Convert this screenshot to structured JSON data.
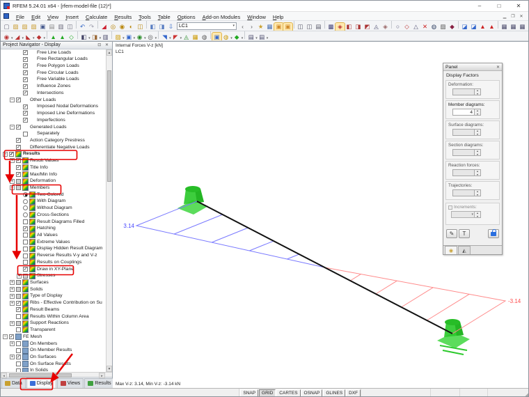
{
  "window": {
    "title": "RFEM 5.24.01 x64 - [rfem-model-file (12)*]",
    "controls": {
      "minimize": "–",
      "maximize": "□",
      "close": "✕"
    }
  },
  "menu": {
    "items": [
      "File",
      "Edit",
      "View",
      "Insert",
      "Calculate",
      "Results",
      "Tools",
      "Table",
      "Options",
      "Add-on Modules",
      "Window",
      "Help"
    ],
    "mdi": [
      "▁",
      "❐",
      "✕"
    ]
  },
  "toolbar": {
    "load_case": "LC1",
    "combo_caret": "▾",
    "row1a": [
      {
        "g": "▢",
        "c": "#667"
      },
      {
        "g": "▨",
        "c": "#c99b2e"
      },
      {
        "g": "▨",
        "c": "#c99b2e"
      },
      {
        "g": "▨",
        "c": "#c99b2e"
      },
      {
        "g": "▣",
        "c": "#44588c"
      },
      {
        "g": "▤",
        "c": "#888"
      },
      {
        "g": "▥",
        "c": "#667"
      },
      {
        "g": "◫",
        "c": "#667"
      },
      {
        "sep": true
      },
      {
        "g": "↶",
        "c": "#2e63c4"
      },
      {
        "g": "↷",
        "c": "#99a"
      },
      {
        "sep": true
      },
      {
        "g": "◢",
        "c": "#c23"
      },
      {
        "g": "◎",
        "c": "#b8860b"
      },
      {
        "g": "◉",
        "c": "#b8860b"
      },
      {
        "g": "◐",
        "c": "#b8860b"
      },
      {
        "g": "◫",
        "c": "#b8860b"
      },
      {
        "sep": true
      },
      {
        "g": "◧",
        "c": "#5a7ec2"
      },
      {
        "g": "◨",
        "c": "#5a7ec2"
      },
      {
        "g": "⇩",
        "c": "#2e63c4"
      }
    ],
    "row1b": [
      {
        "g": "‹",
        "c": "#555"
      },
      {
        "g": "›",
        "c": "#555"
      },
      {
        "g": "★",
        "c": "#caa12e"
      },
      {
        "g": "▦",
        "c": "#4a6faf"
      },
      {
        "g": "▣",
        "c": "#d08a2a",
        "hl": true
      },
      {
        "g": "▣",
        "c": "#d08a2a",
        "hl": true
      },
      {
        "sep": true
      },
      {
        "g": "◫",
        "c": "#556"
      },
      {
        "g": "◫",
        "c": "#556"
      },
      {
        "g": "▤",
        "c": "#556"
      },
      {
        "sep": true
      },
      {
        "g": "▩",
        "c": "#447"
      },
      {
        "g": "◈",
        "c": "#b33",
        "hl": true
      },
      {
        "g": "◧",
        "c": "#a33"
      },
      {
        "g": "◨",
        "c": "#a33"
      },
      {
        "g": "◩",
        "c": "#a33"
      },
      {
        "g": "◬",
        "c": "#557"
      },
      {
        "g": "◈",
        "c": "#966"
      },
      {
        "sep": true
      },
      {
        "g": "○",
        "c": "#557"
      },
      {
        "g": "◇",
        "c": "#b33"
      },
      {
        "g": "△",
        "c": "#557"
      },
      {
        "g": "✕",
        "c": "#c22"
      },
      {
        "g": "◍",
        "c": "#346"
      },
      {
        "g": "▨",
        "c": "#555"
      },
      {
        "g": "◆",
        "c": "#824"
      },
      {
        "sep": true
      },
      {
        "g": "◪",
        "c": "#36c"
      },
      {
        "g": "◪",
        "c": "#36c"
      },
      {
        "g": "▲",
        "c": "#c22"
      },
      {
        "g": "▲",
        "c": "#c22"
      },
      {
        "sep": true
      },
      {
        "g": "▦",
        "c": "#446"
      },
      {
        "g": "▦",
        "c": "#446"
      },
      {
        "g": "▦",
        "c": "#446"
      }
    ],
    "row2": [
      {
        "g": "◉",
        "c": "#b33",
        "dd": true
      },
      {
        "g": "◢",
        "c": "#b33",
        "dd": true
      },
      {
        "g": "◣",
        "c": "#b33",
        "dd": true
      },
      {
        "g": "◆",
        "c": "#b33",
        "dd": true
      },
      {
        "sep": true
      },
      {
        "g": "▲",
        "c": "#2a2"
      },
      {
        "g": "▲",
        "c": "#2a2"
      },
      {
        "g": "◇",
        "c": "#2a2"
      },
      {
        "sep": true
      },
      {
        "g": "◧",
        "c": "#446",
        "dd": true
      },
      {
        "g": "◨",
        "c": "#963",
        "dd": true
      },
      {
        "g": "▥",
        "c": "#446"
      },
      {
        "sep": true
      },
      {
        "g": "▨",
        "c": "#c90",
        "dd": true
      },
      {
        "g": "▣",
        "c": "#36c",
        "dd": true
      },
      {
        "g": "◉",
        "c": "#282",
        "dd": true
      },
      {
        "g": "◎",
        "c": "#555",
        "dd": true
      },
      {
        "sep": true
      },
      {
        "g": "◥",
        "c": "#36c",
        "dd": true
      },
      {
        "g": "◤",
        "c": "#c33",
        "dd": true
      },
      {
        "g": "◬",
        "c": "#282"
      },
      {
        "g": "▦",
        "c": "#c90"
      },
      {
        "g": "◍",
        "c": "#555"
      },
      {
        "sep": true
      },
      {
        "g": "▣",
        "c": "#36c",
        "hl": true
      },
      {
        "g": "◍",
        "c": "#c90",
        "dd": true
      },
      {
        "g": "◆",
        "c": "#2a2",
        "dd": true
      },
      {
        "sep": true
      },
      {
        "g": "▤",
        "c": "#446",
        "dd": true
      },
      {
        "g": "▤",
        "c": "#446",
        "dd": true
      }
    ]
  },
  "navigator": {
    "title": "Project Navigator - Display",
    "pin_icon": "⊡",
    "close_icon": "✕",
    "tree": [
      {
        "label": "Free Line Loads",
        "lv": 2,
        "ctrl": "on",
        "icon": "load"
      },
      {
        "label": "Free Rectangular Loads",
        "lv": 2,
        "ctrl": "on",
        "icon": "load"
      },
      {
        "label": "Free Polygon Loads",
        "lv": 2,
        "ctrl": "on",
        "icon": "load"
      },
      {
        "label": "Free Circular Loads",
        "lv": 2,
        "ctrl": "on",
        "icon": "load"
      },
      {
        "label": "Free Variable Loads",
        "lv": 2,
        "ctrl": "on",
        "icon": "load"
      },
      {
        "label": "Influence Zones",
        "lv": 2,
        "ctrl": "on",
        "icon": "load"
      },
      {
        "label": "Intersections",
        "lv": 2,
        "ctrl": "on",
        "icon": "load"
      },
      {
        "label": "Other Loads",
        "lv": 1,
        "exp": "-",
        "ctrl": "on",
        "icon": "load"
      },
      {
        "label": "Imposed Nodal Deformations",
        "lv": 2,
        "ctrl": "on",
        "icon": "load"
      },
      {
        "label": "Imposed Line Deformations",
        "lv": 2,
        "ctrl": "on",
        "icon": "load"
      },
      {
        "label": "Imperfections",
        "lv": 2,
        "ctrl": "on",
        "icon": "load"
      },
      {
        "label": "Generated Loads",
        "lv": 1,
        "exp": "-",
        "ctrl": "on",
        "icon": "load"
      },
      {
        "label": "Separately",
        "lv": 2,
        "ctrl": "off",
        "icon": "load"
      },
      {
        "label": "Action Category Prestress",
        "lv": 1,
        "ctrl": "on",
        "icon": "load"
      },
      {
        "label": "Differentiate Negative Loads",
        "lv": 1,
        "ctrl": "on",
        "icon": "load"
      },
      {
        "label": "Results",
        "lv": 0,
        "exp": "-",
        "ctrl": "on",
        "icon": "result",
        "bold": true
      },
      {
        "label": "Result Values",
        "lv": 1,
        "exp": "+",
        "ctrl": "on",
        "icon": "result"
      },
      {
        "label": "Title Info",
        "lv": 1,
        "ctrl": "on",
        "icon": "result"
      },
      {
        "label": "Max/Min Info",
        "lv": 1,
        "ctrl": "on",
        "icon": "result"
      },
      {
        "label": "Deformation",
        "lv": 1,
        "exp": "+",
        "ctrl": "part",
        "icon": "result"
      },
      {
        "label": "Members",
        "lv": 1,
        "exp": "-",
        "ctrl": "part",
        "icon": "result"
      },
      {
        "label": "Two-Colored",
        "lv": 2,
        "ctrl": "ron",
        "icon": "result"
      },
      {
        "label": "With Diagram",
        "lv": 2,
        "ctrl": "roff",
        "icon": "result"
      },
      {
        "label": "Without Diagram",
        "lv": 2,
        "ctrl": "roff",
        "icon": "result"
      },
      {
        "label": "Cross-Sections",
        "lv": 2,
        "ctrl": "roff",
        "icon": "result"
      },
      {
        "label": "Result Diagrams Filled",
        "lv": 2,
        "ctrl": "off",
        "icon": "result"
      },
      {
        "label": "Hatching",
        "lv": 2,
        "ctrl": "on",
        "icon": "result"
      },
      {
        "label": "All Values",
        "lv": 2,
        "ctrl": "off",
        "icon": "result"
      },
      {
        "label": "Extreme Values",
        "lv": 2,
        "ctrl": "off",
        "icon": "result"
      },
      {
        "label": "Display Hidden Result Diagram",
        "lv": 2,
        "ctrl": "off",
        "icon": "result"
      },
      {
        "label": "Reverse Results V-y and V-z",
        "lv": 2,
        "ctrl": "off",
        "icon": "result"
      },
      {
        "label": "Results on Couplings",
        "lv": 2,
        "ctrl": "off",
        "icon": "result"
      },
      {
        "label": "Draw in XY-Plane",
        "lv": 2,
        "ctrl": "on",
        "icon": "result"
      },
      {
        "label": "Stresses",
        "lv": 2,
        "exp": "+",
        "ctrl": "part",
        "icon": "result"
      },
      {
        "label": "Surfaces",
        "lv": 1,
        "exp": "+",
        "ctrl": "part",
        "icon": "result"
      },
      {
        "label": "Solids",
        "lv": 1,
        "exp": "+",
        "ctrl": "part",
        "icon": "result"
      },
      {
        "label": "Type of Display",
        "lv": 1,
        "exp": "+",
        "ctrl": "part",
        "icon": "result"
      },
      {
        "label": "Ribs - Effective Contribution on Su",
        "lv": 1,
        "exp": "+",
        "ctrl": "on",
        "icon": "result"
      },
      {
        "label": "Result Beams",
        "lv": 1,
        "ctrl": "on",
        "icon": "result"
      },
      {
        "label": "Results Within Column Area",
        "lv": 1,
        "ctrl": "off",
        "icon": "result"
      },
      {
        "label": "Support Reactions",
        "lv": 1,
        "exp": "+",
        "ctrl": "part",
        "icon": "result"
      },
      {
        "label": "Transparent",
        "lv": 1,
        "ctrl": "off",
        "icon": "result"
      },
      {
        "label": "FE Mesh",
        "lv": 0,
        "exp": "-",
        "ctrl": "on",
        "icon": "mesh"
      },
      {
        "label": "On Members",
        "lv": 1,
        "exp": "+",
        "ctrl": "off",
        "icon": "mesh"
      },
      {
        "label": "On Member Results",
        "lv": 1,
        "ctrl": "off",
        "icon": "mesh"
      },
      {
        "label": "On Surfaces",
        "lv": 1,
        "exp": "+",
        "ctrl": "on",
        "icon": "mesh"
      },
      {
        "label": "On Surface Results",
        "lv": 1,
        "ctrl": "off",
        "icon": "mesh"
      },
      {
        "label": "In Solids",
        "lv": 1,
        "ctrl": "off",
        "icon": "mesh"
      }
    ],
    "tabs": [
      {
        "label": "Data",
        "icon_color": "#c8a030",
        "active": false
      },
      {
        "label": "Display",
        "icon_color": "#3a6fd8",
        "active": true
      },
      {
        "label": "Views",
        "icon_color": "#c04040",
        "active": false
      },
      {
        "label": "Results",
        "icon_color": "#40a040",
        "active": false
      }
    ]
  },
  "canvas": {
    "header1": "Internal Forces V-z [kN]",
    "header2": "LC1",
    "footer": "Max V-z: 3.14, Min V-z: -3.14 kN",
    "diagram": {
      "max_label": "3.14",
      "min_label": "-3.14",
      "beam_color": "#111111",
      "positive_color": "#7878ff",
      "negative_color": "#ff8a8a",
      "support_color": "#2ed22e",
      "max_label_color": "#4646ff",
      "min_label_color": "#ff4a4a"
    }
  },
  "panel": {
    "title": "Panel",
    "close_icon": "✕",
    "section": "Display Factors",
    "fields": [
      {
        "label": "Deformation:",
        "value": "",
        "enabled": false
      },
      {
        "label": "Member diagrams:",
        "value": "4",
        "enabled": true
      },
      {
        "label": "Surface diagrams:",
        "value": "",
        "enabled": false
      },
      {
        "label": "Section diagrams:",
        "value": "",
        "enabled": false
      },
      {
        "label": "Reaction forces:",
        "value": "",
        "enabled": false
      },
      {
        "label": "Trajectories:",
        "value": "",
        "enabled": false
      }
    ],
    "increments": {
      "label": "Increments:",
      "enabled": false
    }
  },
  "statusbar": {
    "buttons": [
      {
        "label": "SNAP",
        "pressed": false
      },
      {
        "label": "GRID",
        "pressed": true
      },
      {
        "label": "CARTES",
        "pressed": false
      },
      {
        "label": "OSNAP",
        "pressed": false
      },
      {
        "label": "GLINES",
        "pressed": false
      },
      {
        "label": "DXF",
        "pressed": false
      }
    ]
  },
  "annotations": {
    "color": "#e60000"
  }
}
